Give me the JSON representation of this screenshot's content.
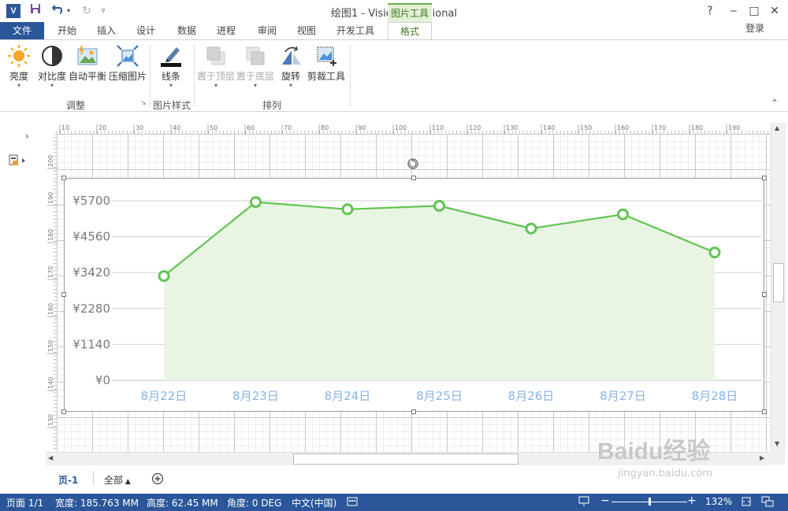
{
  "window": {
    "title": "绘图1 - Visio Professional",
    "app_icon_text": "V",
    "context_tab_group": "图片工具",
    "help": "?",
    "login": "登录"
  },
  "tabs": [
    "开始",
    "插入",
    "设计",
    "数据",
    "进程",
    "审阅",
    "视图",
    "开发工具"
  ],
  "tab_file": "文件",
  "tab_active": "格式",
  "ribbon": {
    "groups": [
      {
        "label": "调整",
        "buttons": [
          {
            "label": "亮度",
            "icon": "sun-icon",
            "enabled": true
          },
          {
            "label": "对比度",
            "icon": "contrast-icon",
            "enabled": true
          },
          {
            "label": "自动平衡",
            "icon": "auto-balance-icon",
            "enabled": true
          },
          {
            "label": "压缩图片",
            "icon": "compress-icon",
            "enabled": true
          }
        ]
      },
      {
        "label": "图片样式",
        "buttons": [
          {
            "label": "线条",
            "icon": "line-pen-icon",
            "enabled": true
          }
        ]
      },
      {
        "label": "排列",
        "buttons": [
          {
            "label": "置于顶层",
            "icon": "bring-front-icon",
            "enabled": false
          },
          {
            "label": "置于底层",
            "icon": "send-back-icon",
            "enabled": false
          },
          {
            "label": "旋转",
            "icon": "rotate-icon",
            "enabled": true
          },
          {
            "label": "剪裁工具",
            "icon": "crop-icon",
            "enabled": true
          }
        ]
      }
    ]
  },
  "ruler": {
    "top_ticks": [
      "10",
      "20",
      "30",
      "40",
      "50",
      "60",
      "70",
      "80",
      "90",
      "100",
      "110",
      "120",
      "130",
      "140",
      "150",
      "160",
      "170",
      "180",
      "190"
    ],
    "left_ticks": [
      "200",
      "190",
      "180",
      "170",
      "160",
      "150",
      "140",
      "130"
    ]
  },
  "chart_data": {
    "type": "area",
    "categories": [
      "8月22日",
      "8月23日",
      "8月24日",
      "8月25日",
      "8月26日",
      "8月27日",
      "8月28日"
    ],
    "values": [
      3310,
      5660,
      5430,
      5540,
      4820,
      5270,
      4060
    ],
    "y_ticks": [
      "¥0",
      "¥1140",
      "¥2280",
      "¥3420",
      "¥4560",
      "¥5700"
    ],
    "ylim": [
      0,
      5700
    ],
    "grid": true,
    "line_color": "#62c451",
    "fill_color": "#e8f5e3",
    "tick_color": "#88b4e6"
  },
  "page_tabs": {
    "current": "页-1",
    "all": "全部"
  },
  "status": {
    "page": "页面 1/1",
    "width": "宽度: 185.763 MM",
    "height": "高度: 62.45 MM",
    "angle": "角度: 0 DEG",
    "language": "中文(中国)",
    "zoom": "132%",
    "zoom_minus": "−",
    "zoom_plus": "+",
    "zoom_level": 0.5
  },
  "watermark": {
    "text": "Baidu经验",
    "sub": "jingyan.baidu.com"
  }
}
